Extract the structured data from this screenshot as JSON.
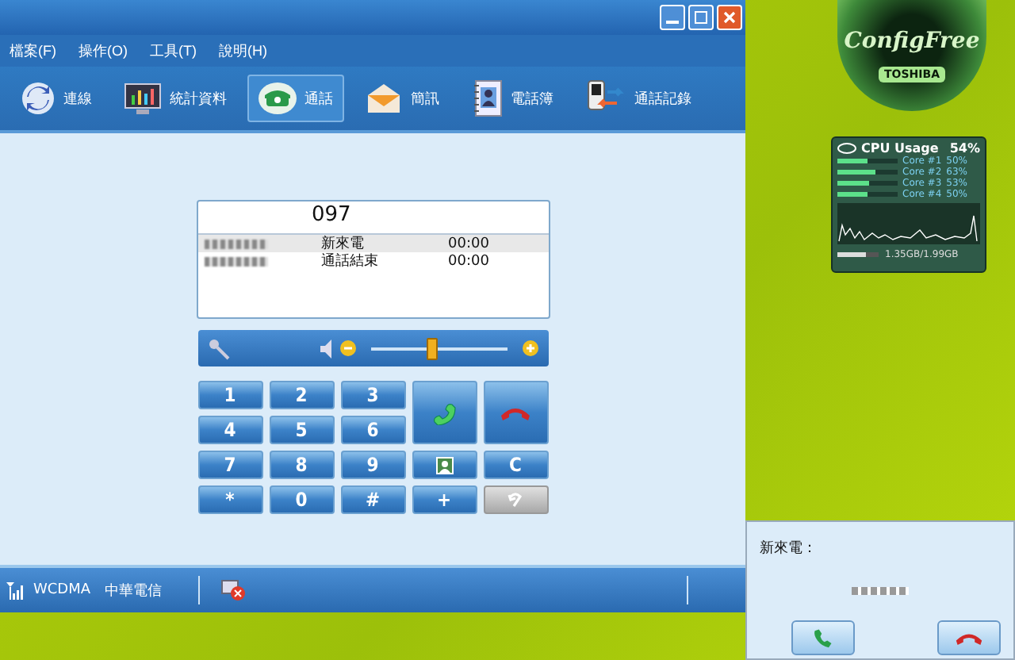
{
  "menu": [
    {
      "label": "檔案(F)"
    },
    {
      "label": "操作(O)"
    },
    {
      "label": "工具(T)"
    },
    {
      "label": "說明(H)"
    }
  ],
  "toolbar": [
    {
      "kind": "connect",
      "label": "連線",
      "selected": false
    },
    {
      "kind": "stats",
      "label": "統計資料",
      "selected": false
    },
    {
      "kind": "call",
      "label": "通話",
      "selected": true
    },
    {
      "kind": "sms",
      "label": "簡訊",
      "selected": false
    },
    {
      "kind": "phonebook",
      "label": "電話簿",
      "selected": false
    },
    {
      "kind": "log",
      "label": "通話記錄",
      "selected": false
    }
  ],
  "call_display": {
    "number": "097",
    "entries": [
      {
        "status": "新來電",
        "time": "00:00",
        "selected": true
      },
      {
        "status": "通話結束",
        "time": "00:00",
        "selected": false
      }
    ]
  },
  "volume": {
    "level": 0.45
  },
  "keypad": [
    {
      "kind": "text",
      "label": "1",
      "disabled": false
    },
    {
      "kind": "text",
      "label": "2",
      "disabled": false
    },
    {
      "kind": "text",
      "label": "3",
      "disabled": false
    },
    {
      "kind": "text",
      "label": "4",
      "disabled": false
    },
    {
      "kind": "text",
      "label": "5",
      "disabled": false
    },
    {
      "kind": "text",
      "label": "6",
      "disabled": false
    },
    {
      "kind": "text",
      "label": "7",
      "disabled": false
    },
    {
      "kind": "text",
      "label": "8",
      "disabled": false
    },
    {
      "kind": "text",
      "label": "9",
      "disabled": false
    },
    {
      "kind": "text",
      "label": "*",
      "disabled": false
    },
    {
      "kind": "text",
      "label": "0",
      "disabled": false
    },
    {
      "kind": "text",
      "label": "#",
      "disabled": false
    },
    {
      "kind": "call",
      "disabled": false
    },
    {
      "kind": "hangup",
      "disabled": false
    },
    {
      "kind": "contacts",
      "disabled": false
    },
    {
      "kind": "text",
      "label": "C",
      "disabled": false
    },
    {
      "kind": "text",
      "label": "+",
      "disabled": false
    },
    {
      "kind": "back",
      "disabled": true
    }
  ],
  "status_bar": {
    "network": "WCDMA",
    "carrier": "中華電信"
  },
  "gadget": {
    "brand": "ConfigFree",
    "maker": "TOSHIBA"
  },
  "cpu": {
    "title": "CPU Usage",
    "total": "54%",
    "cores": [
      {
        "name": "Core #1",
        "value": "50%",
        "level": 0.5
      },
      {
        "name": "Core #2",
        "value": "63%",
        "level": 0.63
      },
      {
        "name": "Core #3",
        "value": "53%",
        "level": 0.53
      },
      {
        "name": "Core #4",
        "value": "50%",
        "level": 0.5
      }
    ],
    "memory": {
      "text": "1.35GB/1.99GB",
      "level": 0.68
    }
  },
  "popup": {
    "title": "新來電："
  }
}
